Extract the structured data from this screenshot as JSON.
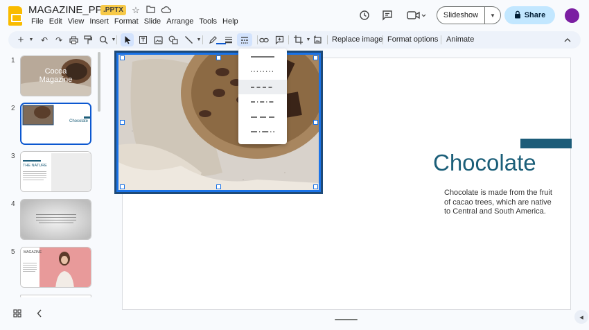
{
  "header": {
    "doc_title": "MAGAZINE_PPTX",
    "file_badge": ".PPTX",
    "menu": [
      "File",
      "Edit",
      "View",
      "Insert",
      "Format",
      "Slide",
      "Arrange",
      "Tools",
      "Help"
    ],
    "slideshow_label": "Slideshow",
    "share_label": "Share"
  },
  "toolbar": {
    "replace_image": "Replace image",
    "format_options": "Format options",
    "animate": "Animate"
  },
  "filmstrip": {
    "slides": [
      {
        "num": "1",
        "title_line1": "Cocoa",
        "title_line2": "Magazine"
      },
      {
        "num": "2",
        "title": "Chocolate"
      },
      {
        "num": "3",
        "heading": "THE NATURE"
      },
      {
        "num": "4"
      },
      {
        "num": "5",
        "heading": "MAGAZINE"
      }
    ]
  },
  "slide": {
    "title": "Chocolate",
    "body": "Chocolate is made from the fruit of cacao trees, which are native to Central and South America."
  },
  "dash_menu": {
    "options": [
      "solid",
      "dotted",
      "dashed",
      "dash-dot",
      "long-dash",
      "long-dash-dot"
    ],
    "highlighted": "dashed"
  },
  "colors": {
    "accent": "#0b57d0",
    "title_teal": "#1c5f79",
    "share_bg": "#c2e7ff",
    "badge_bg": "#f7c948",
    "avatar": "#7b1fa2"
  }
}
